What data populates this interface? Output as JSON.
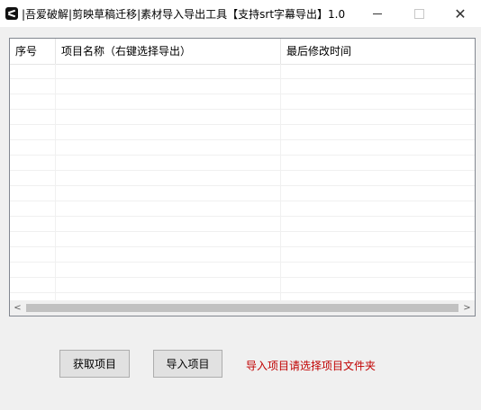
{
  "window": {
    "title": "|吾爱破解|剪映草稿迁移|素材导入导出工具【支持srt字幕导出】1.0",
    "close_glyph": "✕"
  },
  "table": {
    "columns": [
      "序号",
      "项目名称（右键选择导出）",
      "最后修改时间"
    ],
    "rows": []
  },
  "buttons": {
    "get_projects": "获取项目",
    "import_project": "导入项目"
  },
  "hint": "导入项目请选择项目文件夹",
  "scrollbar": {
    "left_arrow": "<",
    "right_arrow": ">"
  },
  "colors": {
    "hint": "#c00000"
  }
}
